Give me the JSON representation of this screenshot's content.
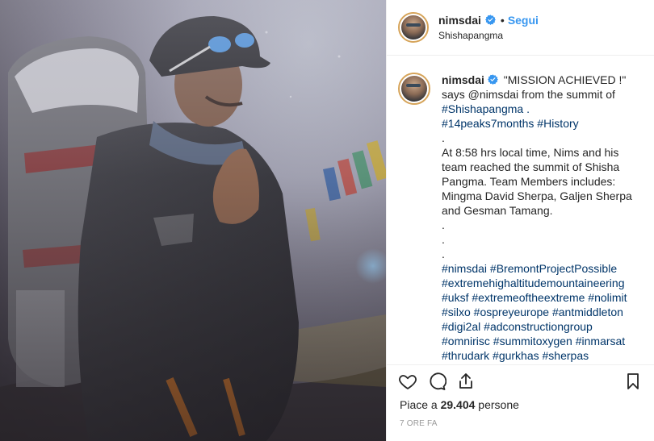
{
  "header": {
    "username": "nimsdai",
    "dot": "•",
    "follow_label": "Segui",
    "location": "Shishapangma"
  },
  "caption": {
    "username": "nimsdai",
    "lines": [
      "\"MISSION ACHIEVED !\"",
      "says @nimsdai from the summit of",
      "#Shishapangma .",
      " #14peaks7months #History",
      ".",
      "At 8:58 hrs local time, Nims and his",
      "team reached the summit of Shisha",
      "Pangma. Team Members includes:",
      "Mingma David Sherpa, Galjen Sherpa",
      "and Gesman Tamang.",
      ".",
      ".",
      ".",
      "#nimsdai #BremontProjectPossible",
      "#extremehighaltitudemountaineering",
      "#uksf #extremeoftheextreme #nolimit",
      "#silxo #ospreyeurope #antmiddleton",
      "#digi2al #adconstructiongroup",
      "#omnirisc #summitoxygen #inmarsat",
      "#thrudark #gurkhas #sherpas"
    ]
  },
  "footer": {
    "likes_prefix": "Piace a ",
    "likes_count": "29.404",
    "likes_suffix": " persone",
    "timestamp": "7 ORE FA"
  },
  "icons": {
    "like": "heart-icon",
    "comment": "comment-icon",
    "share": "share-icon",
    "save": "bookmark-icon",
    "verified": "verified-badge-icon"
  },
  "colors": {
    "link": "#003569",
    "follow": "#3897f0",
    "verified": "#3897f0",
    "timestamp": "#999999",
    "avatar_ring": "#d6a45a"
  }
}
